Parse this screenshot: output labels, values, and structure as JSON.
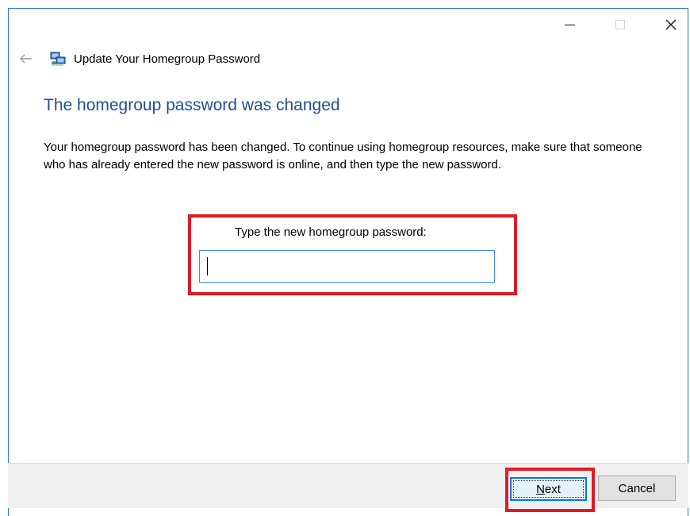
{
  "window": {
    "title": "Update Your Homegroup Password",
    "controls": {
      "minimize_icon": "minimize-icon",
      "maximize_icon": "maximize-icon",
      "close_icon": "close-icon"
    }
  },
  "nav": {
    "back_icon": "back-arrow-icon",
    "app_icon": "homegroup-icon"
  },
  "content": {
    "heading": "The homegroup password was changed",
    "description": "Your homegroup password has been changed. To continue using homegroup resources, make sure that someone who has already entered the new password is online, and then type the new password.",
    "password_label": "Type the new homegroup password:",
    "password_value": ""
  },
  "footer": {
    "next_mnemonic": "N",
    "next_rest": "ext",
    "cancel_label": "Cancel"
  },
  "colors": {
    "heading": "#1f4e96",
    "highlight": "#e11b26",
    "accent": "#0078d7"
  }
}
